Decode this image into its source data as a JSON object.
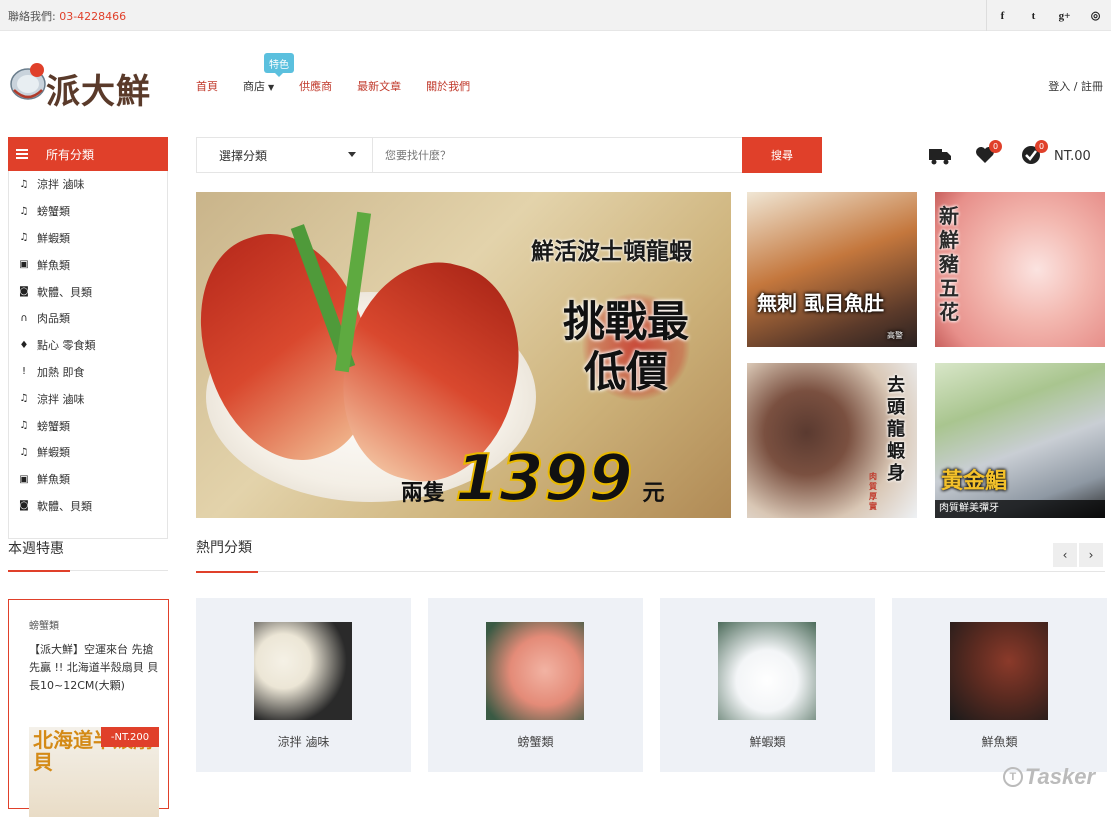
{
  "topbar": {
    "contact_label": "聯絡我們:",
    "phone": "03-4228466",
    "social": [
      {
        "icon": "facebook-icon",
        "glyph": "f"
      },
      {
        "icon": "twitter-icon",
        "glyph": "t"
      },
      {
        "icon": "google-plus-icon",
        "glyph": "g+"
      },
      {
        "icon": "instagram-icon",
        "glyph": "◎"
      }
    ]
  },
  "logo": {
    "text": "派大鮮",
    "mark": "派"
  },
  "nav": {
    "items": [
      "首頁",
      "商店",
      "供應商",
      "最新文章",
      "關於我們"
    ],
    "feature_badge": "特色"
  },
  "account": {
    "login_label": "登入 / 註冊"
  },
  "categories": {
    "header": "所有分類",
    "items": [
      {
        "icon": "music-note-icon",
        "label": "涼拌 滷味"
      },
      {
        "icon": "music-note-icon",
        "label": "螃蟹類"
      },
      {
        "icon": "music-note-icon",
        "label": "鮮蝦類"
      },
      {
        "icon": "briefcase-icon",
        "label": "鮮魚類"
      },
      {
        "icon": "camera-icon",
        "label": "軟體、貝類"
      },
      {
        "icon": "headphones-icon",
        "label": "肉品類"
      },
      {
        "icon": "microphone-icon",
        "label": "點心 零食類"
      },
      {
        "icon": "pin-icon",
        "label": "加熱 即食"
      },
      {
        "icon": "music-note-icon",
        "label": "涼拌 滷味"
      },
      {
        "icon": "music-note-icon",
        "label": "螃蟹類"
      },
      {
        "icon": "music-note-icon",
        "label": "鮮蝦類"
      },
      {
        "icon": "briefcase-icon",
        "label": "鮮魚類"
      },
      {
        "icon": "camera-icon",
        "label": "軟體、貝類"
      }
    ]
  },
  "search": {
    "category_label": "選擇分類",
    "placeholder": "您要找什麼？",
    "button_label": "搜尋"
  },
  "header_icons": {
    "wishlist_count": "0",
    "compare_count": "0",
    "cart_total": "NT.00"
  },
  "banner": {
    "headline": "鮮活波士頓龍蝦",
    "tagline": "挑戰最低價",
    "price_prefix": "兩隻",
    "price": "1399",
    "price_suffix": "元"
  },
  "promo_tiles": [
    {
      "caption": "無刺 虱目魚肚",
      "sub": "高警"
    },
    {
      "caption": "新鮮豬五花",
      "sub": ""
    },
    {
      "caption": "去頭龍蝦身",
      "sub": "肉質厚實"
    },
    {
      "caption": "黃金鯧",
      "sub": "肉質鮮美彈牙"
    }
  ],
  "weekly": {
    "title": "本週特惠",
    "category": "螃蟹類",
    "description": "【派大鮮】空運來台 先搶先贏 !! 北海道半殼扇貝 貝長10~12CM(大顆)",
    "price_tag": "-NT.200",
    "image_text": "北海道半殼扇貝"
  },
  "hot": {
    "title": "熱門分類",
    "items": [
      "涼拌 滷味",
      "螃蟹類",
      "鮮蝦類",
      "鮮魚類"
    ]
  },
  "watermark": {
    "text": "Tasker"
  },
  "colors": {
    "accent": "#e0402a",
    "badge": "#5bc0de",
    "card_bg": "#eef1f6"
  }
}
